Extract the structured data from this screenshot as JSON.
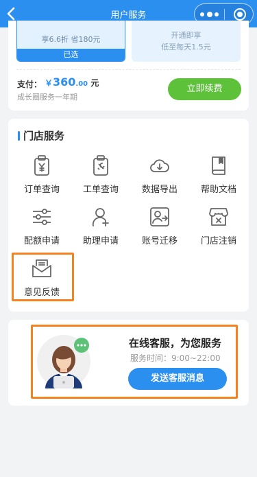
{
  "header": {
    "title": "用户服务"
  },
  "plans": [
    {
      "line1": "享6.6折 省180元",
      "selected_label": "已选"
    },
    {
      "line1": "开通即享",
      "line2": "低至每天1.5元"
    }
  ],
  "payment": {
    "label": "支付：",
    "currency": "￥",
    "amount_int": "360",
    "amount_dec": ".00",
    "unit": "元",
    "description": "成长圈服务一年期",
    "renew_button": "立即续费"
  },
  "store_section": {
    "title": "门店服务",
    "items": [
      {
        "label": "订单查询",
        "icon": "order-icon"
      },
      {
        "label": "工单查询",
        "icon": "ticket-icon"
      },
      {
        "label": "数据导出",
        "icon": "cloud-download-icon"
      },
      {
        "label": "帮助文档",
        "icon": "book-icon"
      },
      {
        "label": "配额申请",
        "icon": "sliders-icon"
      },
      {
        "label": "助理申请",
        "icon": "user-add-icon"
      },
      {
        "label": "账号迁移",
        "icon": "account-transfer-icon"
      },
      {
        "label": "门店注销",
        "icon": "store-close-icon"
      },
      {
        "label": "意见反馈",
        "icon": "mail-icon"
      }
    ]
  },
  "customer_service": {
    "title": "在线客服，为您服务",
    "hours": "服务时间：9:00~22:00",
    "button": "发送客服消息"
  },
  "colors": {
    "primary": "#2b8ff0",
    "renew_green": "#5ec13a",
    "highlight_orange": "#f5821f",
    "page_bg": "#f2f3f5"
  }
}
